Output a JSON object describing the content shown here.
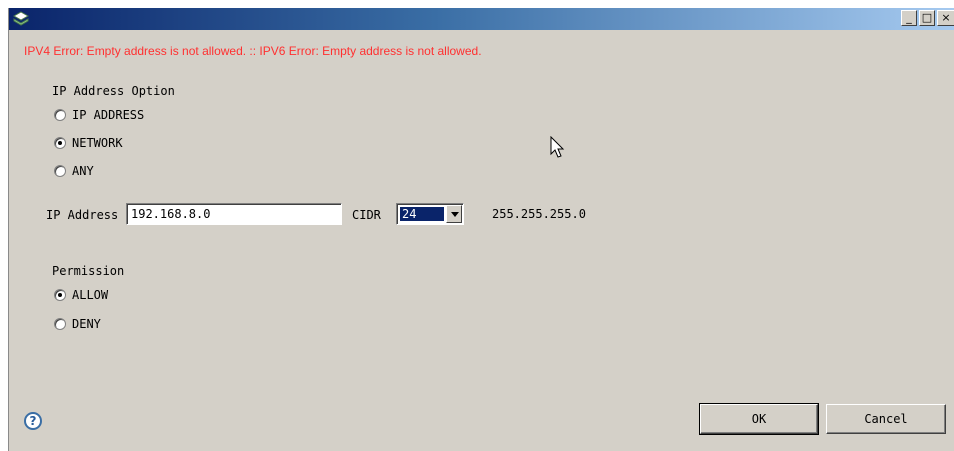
{
  "window": {
    "title": "",
    "controls": [
      "_",
      "□",
      "×"
    ]
  },
  "error_message": "IPV4 Error: Empty address is not allowed. :: IPV6 Error: Empty address is not allowed.",
  "ip_option": {
    "label": "IP Address Option",
    "options": [
      {
        "label": "IP ADDRESS",
        "checked": false
      },
      {
        "label": "NETWORK",
        "checked": true
      },
      {
        "label": "ANY",
        "checked": false
      }
    ]
  },
  "address": {
    "label": "IP Address",
    "value": "192.168.8.0",
    "cidr_label": "CIDR",
    "cidr_value": "24",
    "netmask": "255.255.255.0"
  },
  "permission": {
    "label": "Permission",
    "options": [
      {
        "label": "ALLOW",
        "checked": true
      },
      {
        "label": "DENY",
        "checked": false
      }
    ]
  },
  "buttons": {
    "help": "?",
    "ok": "OK",
    "cancel": "Cancel"
  },
  "icons": {
    "app": "app-icon",
    "help": "help-icon",
    "cursor": "mouse-cursor-icon"
  },
  "colors": {
    "error": "#ff3030",
    "title_start": "#0a246a",
    "title_end": "#a6caf0",
    "face": "#d4d0c8"
  }
}
